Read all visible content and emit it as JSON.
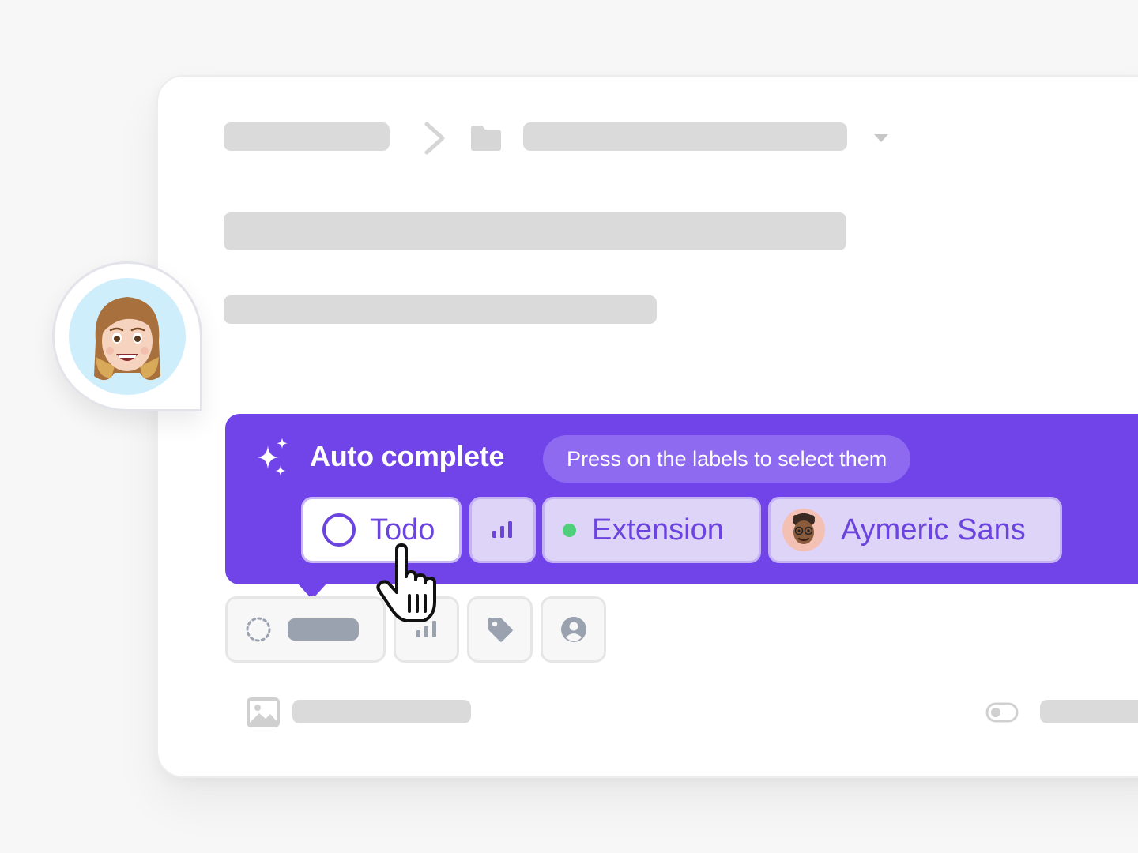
{
  "autocomplete": {
    "title": "Auto complete",
    "hint": "Press on the labels to select them",
    "chips": {
      "status": "Todo",
      "label": "Extension",
      "assignee": "Aymeric Sans"
    }
  },
  "icons": {
    "breadcrumb_separator": "chevron-right-icon",
    "folder": "folder-icon",
    "dropdown": "caret-down-icon",
    "sparkle": "sparkle-icon",
    "status": "circle-icon",
    "priority": "bar-chart-icon",
    "label": "tag-icon",
    "assignee": "user-circle-icon",
    "image": "image-icon",
    "toggle": "toggle-icon",
    "cursor": "hand-pointer-icon"
  },
  "colors": {
    "accent": "#7144ea",
    "chip_text": "#6b43df",
    "label_dot": "#4fcf7b",
    "skeleton": "#dadada"
  }
}
